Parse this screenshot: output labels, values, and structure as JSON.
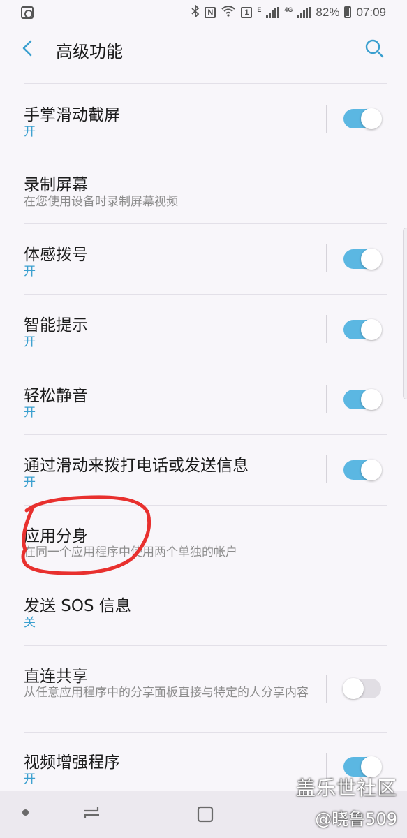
{
  "status_bar": {
    "battery": "82%",
    "time": "07:09",
    "network_type": "4G",
    "sim_number": "1",
    "signal_label": "E",
    "icons": [
      "app-icon",
      "bluetooth-icon",
      "nfc-icon",
      "wifi-icon",
      "sim-icon",
      "signal-icon",
      "battery-icon"
    ]
  },
  "header": {
    "title": "高级功能",
    "back_icon": "back-arrow-icon",
    "search_icon": "search-icon"
  },
  "settings": [
    {
      "title": "手掌滑动截屏",
      "subtitle": "开",
      "has_toggle": true,
      "toggle_on": true
    },
    {
      "title": "录制屏幕",
      "subtitle": "在您使用设备时录制屏幕视频",
      "has_toggle": false
    },
    {
      "title": "体感拨号",
      "subtitle": "开",
      "has_toggle": true,
      "toggle_on": true
    },
    {
      "title": "智能提示",
      "subtitle": "开",
      "has_toggle": true,
      "toggle_on": true
    },
    {
      "title": "轻松静音",
      "subtitle": "开",
      "has_toggle": true,
      "toggle_on": true
    },
    {
      "title": "通过滑动来拨打电话或发送信息",
      "subtitle": "开",
      "has_toggle": true,
      "toggle_on": true
    },
    {
      "title": "应用分身",
      "subtitle": "在同一个应用程序中使用两个单独的帐户",
      "has_toggle": false
    },
    {
      "title": "发送 SOS 信息",
      "subtitle": "关",
      "has_toggle": false
    },
    {
      "title": "直连共享",
      "subtitle": "从任意应用程序中的分享面板直接与特定的人分享内容",
      "has_toggle": true,
      "toggle_on": false
    },
    {
      "title": "视频增强程序",
      "subtitle": "开",
      "has_toggle": true,
      "toggle_on": true
    }
  ],
  "colors": {
    "accent": "#3a9fcf",
    "toggle_on": "#5bb7e2",
    "annotation": "#e8302e"
  },
  "nav_bar": {
    "icons": [
      "recent-dot-icon",
      "recents-icon",
      "home-icon"
    ]
  },
  "watermark": {
    "line1": "盖乐世社区",
    "line2": "@晓鲁509"
  }
}
